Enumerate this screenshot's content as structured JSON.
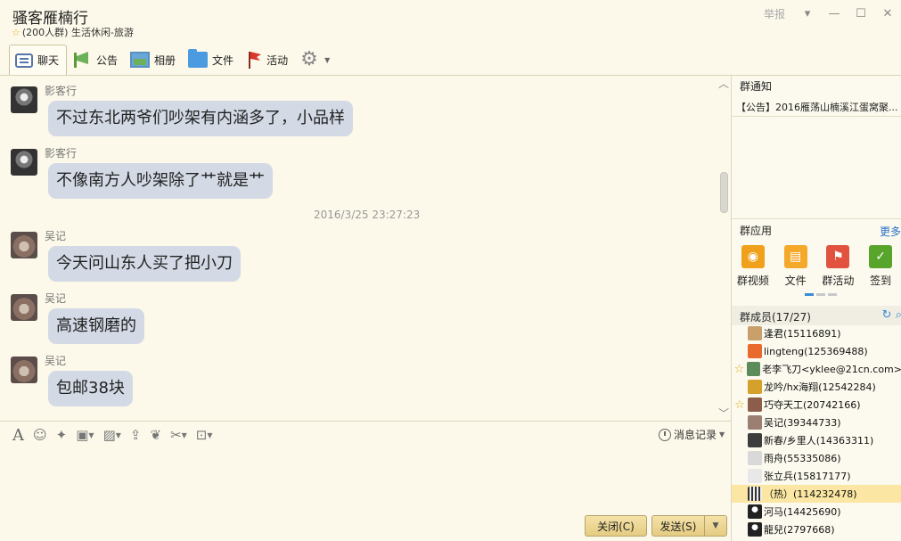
{
  "window": {
    "title": "骚客雁楠行",
    "subtitle": "(200人群) 生活休闲-旅游",
    "report_label": "举报",
    "controls": [
      "▾",
      "—",
      "☐",
      "✕"
    ]
  },
  "tabs": [
    {
      "label": "聊天",
      "icon": "chat-icon"
    },
    {
      "label": "公告",
      "icon": "megaphone-icon"
    },
    {
      "label": "相册",
      "icon": "photo-icon"
    },
    {
      "label": "文件",
      "icon": "folder-icon"
    },
    {
      "label": "活动",
      "icon": "flag-icon"
    }
  ],
  "chat": {
    "messages": [
      {
        "sender": "影客行",
        "text": "不过东北两爷们吵架有内涵多了，小品样",
        "avatar": "shadow"
      },
      {
        "sender": "影客行",
        "text": "不像南方人吵架除了艹就是艹",
        "avatar": "shadow"
      },
      {
        "sender": "吴记",
        "text": "今天问山东人买了把小刀",
        "avatar": "wolf"
      },
      {
        "sender": "吴记",
        "text": "高速钢磨的",
        "avatar": "wolf"
      },
      {
        "sender": "吴记",
        "text": "包邮38块",
        "avatar": "wolf"
      }
    ],
    "timestamp": "2016/3/25 23:27:23"
  },
  "input": {
    "history_label": "消息记录",
    "close_label": "关闭(C)",
    "send_label": "发送(S)"
  },
  "right_panel": {
    "notice_title": "群通知",
    "notice_text": "【公告】2016雁荡山楠溪江蛋窝聚...",
    "apps_title": "群应用",
    "more_label": "更多",
    "apps": [
      {
        "label": "群视频",
        "color": "#f0a11c",
        "glyph": "◉"
      },
      {
        "label": "文件",
        "color": "#f4a92a",
        "glyph": "▤"
      },
      {
        "label": "群活动",
        "color": "#e2533f",
        "glyph": "⚑"
      },
      {
        "label": "签到",
        "color": "#58a52c",
        "glyph": "✓"
      }
    ],
    "members_title": "群成员(17/27)",
    "members": [
      {
        "name": "逢君(15116891)",
        "star": false,
        "selected": false,
        "color": "#c9a06b"
      },
      {
        "name": "lingteng(125369488)",
        "star": false,
        "selected": false,
        "color": "#e86b2d"
      },
      {
        "name": "老李飞刀<yklee@21cn.com>",
        "star": true,
        "selected": false,
        "color": "#5b8c5a"
      },
      {
        "name": "龙吟/hx海翔(12542284)",
        "star": false,
        "selected": false,
        "color": "#d5a02c"
      },
      {
        "name": "巧夺天工(20742166)",
        "star": true,
        "selected": false,
        "color": "#8c5d4a"
      },
      {
        "name": "吴记(39344733)",
        "star": false,
        "selected": false,
        "color": "#9a7f72"
      },
      {
        "name": "新春/乡里人(14363311)",
        "star": false,
        "selected": false,
        "color": "#3d3d3d"
      },
      {
        "name": "雨舟(55335086)",
        "star": false,
        "selected": false,
        "color": "#d9d9d9"
      },
      {
        "name": "张立兵(15817177)",
        "star": false,
        "selected": false,
        "color": "#e8e8e8"
      },
      {
        "name": "（热）(114232478)",
        "star": false,
        "selected": true,
        "color": "#666666"
      },
      {
        "name": "河马(14425690)",
        "star": false,
        "selected": false,
        "color": "#222222"
      },
      {
        "name": "龍兒(2797668)",
        "star": false,
        "selected": false,
        "color": "#222222"
      }
    ]
  }
}
